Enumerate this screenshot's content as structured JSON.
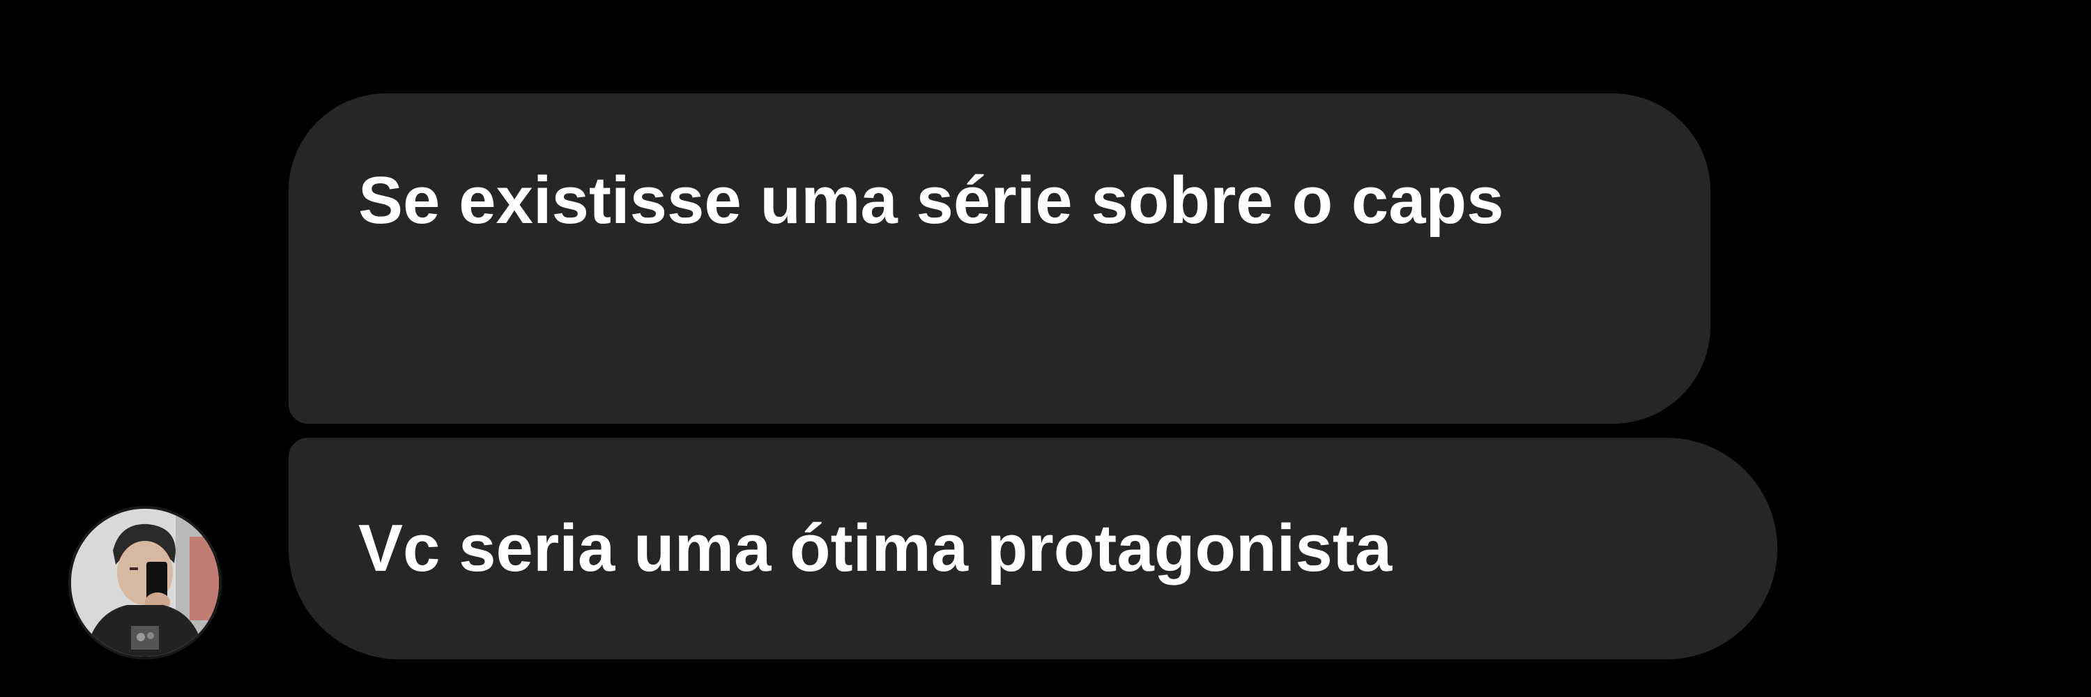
{
  "conversation": {
    "messages": [
      {
        "text": "Se existisse uma série sobre o caps"
      },
      {
        "text": "Vc seria uma ótima protagonista"
      }
    ],
    "sender_avatar_icon": "user-avatar-icon"
  },
  "colors": {
    "background": "#000000",
    "bubble": "#262626",
    "text": "#ffffff"
  }
}
